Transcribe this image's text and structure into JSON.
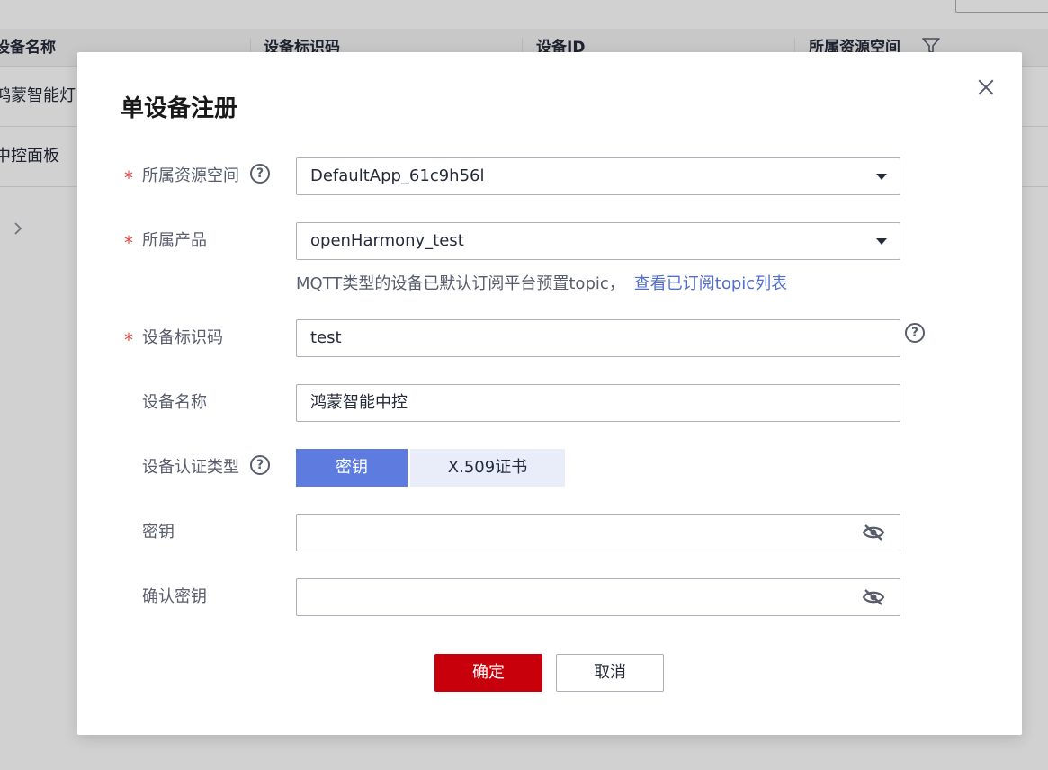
{
  "background": {
    "columns": [
      "设备名称",
      "设备标识码",
      "设备ID",
      "所属资源空间"
    ],
    "rows": [
      {
        "name": "鸿蒙智能灯"
      },
      {
        "name": "中控面板"
      }
    ]
  },
  "dialog": {
    "title": "单设备注册",
    "fields": {
      "resource_space": {
        "label": "所属资源空间",
        "value": "DefaultApp_61c9h56l"
      },
      "product": {
        "label": "所属产品",
        "value": "openHarmony_test"
      },
      "hint": {
        "text": "MQTT类型的设备已默认订阅平台预置topic，",
        "link": "查看已订阅topic列表"
      },
      "identifier": {
        "label": "设备标识码",
        "value": "test"
      },
      "device_name": {
        "label": "设备名称",
        "value": "鸿蒙智能中控"
      },
      "auth_type": {
        "label": "设备认证类型",
        "options": [
          "密钥",
          "X.509证书"
        ],
        "selected": "密钥"
      },
      "secret": {
        "label": "密钥",
        "value": ""
      },
      "confirm_secret": {
        "label": "确认密钥",
        "value": ""
      }
    },
    "buttons": {
      "ok": "确定",
      "cancel": "取消"
    }
  },
  "colors": {
    "primary": "#5e7ce0",
    "danger": "#c7000b",
    "link": "#526ecc",
    "required": "#e54545"
  }
}
